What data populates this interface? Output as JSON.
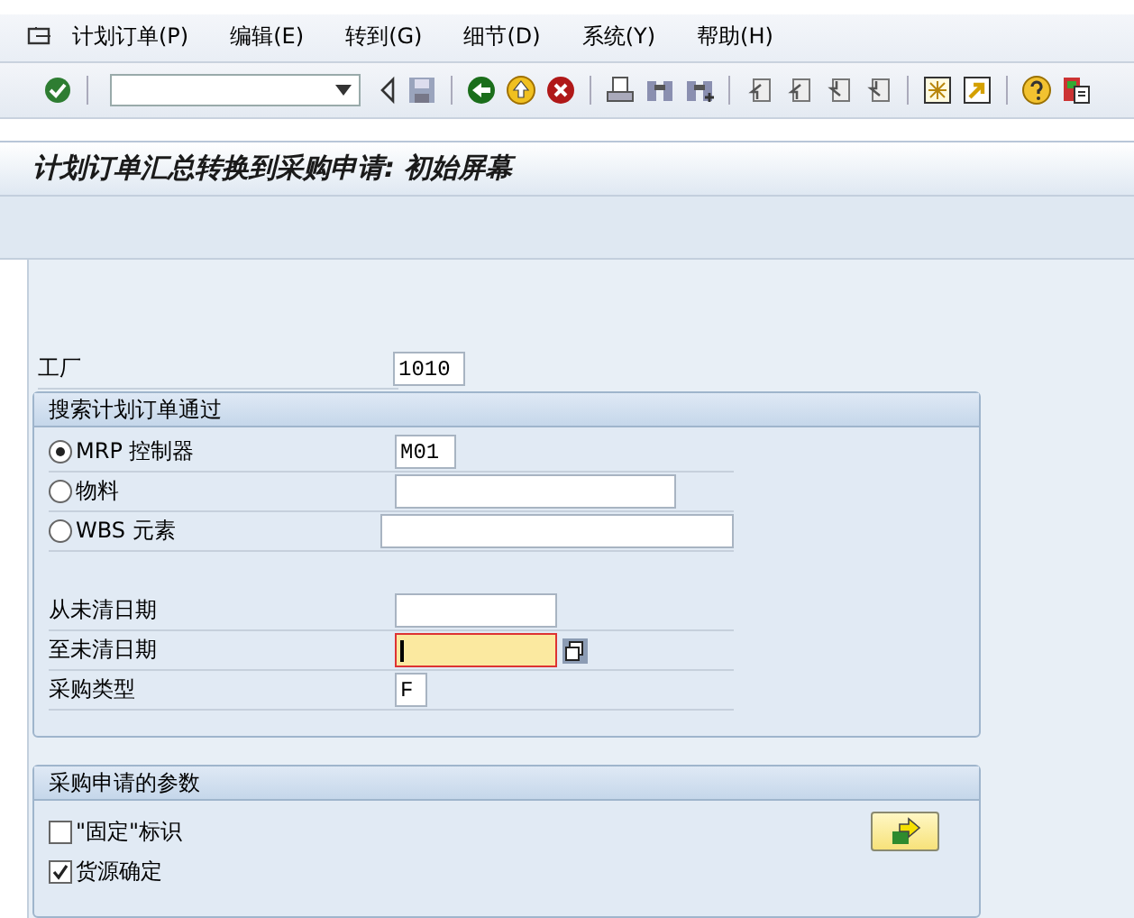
{
  "menu": [
    {
      "label": "计划订单(P)"
    },
    {
      "label": "编辑(E)"
    },
    {
      "label": "转到(G)"
    },
    {
      "label": "细节(D)"
    },
    {
      "label": "系统(Y)"
    },
    {
      "label": "帮助(H)"
    }
  ],
  "title": "计划订单汇总转换到采购申请: 初始屏幕",
  "plant": {
    "label": "工厂",
    "value": "1010"
  },
  "search_group": {
    "title": "搜索计划订单通过",
    "options": [
      {
        "label": "MRP 控制器",
        "selected": true,
        "value": "M01"
      },
      {
        "label": "物料",
        "selected": false
      },
      {
        "label": "WBS 元素",
        "selected": false
      }
    ]
  },
  "date_fields": [
    {
      "label": "从未清日期",
      "focused": false
    },
    {
      "label": "至未清日期",
      "focused": true
    },
    {
      "label": "采购类型",
      "focused": false,
      "value": "F"
    }
  ],
  "params_group": {
    "title": "采购申请的参数",
    "checkboxes": [
      {
        "label": "\"固定\"标识",
        "checked": false
      },
      {
        "label": "货源确定",
        "checked": true
      }
    ]
  }
}
